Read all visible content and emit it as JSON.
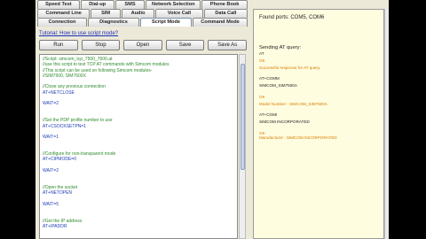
{
  "tabs": {
    "row1": [
      "Speed Test",
      "Dial-up",
      "SMS",
      "Network Selection",
      "Phone Book"
    ],
    "row2": [
      "Command Line",
      "SIM",
      "Audio",
      "Voice Call",
      "Data Call"
    ],
    "row3": [
      "Connection",
      "Diagnostics",
      "Script Mode",
      "Command Mode"
    ],
    "active": "Script Mode"
  },
  "tutorial_link": "Tutorial: How to use script mode?",
  "toolbar": {
    "run": "Run",
    "stop": "Stop",
    "open": "Open",
    "save": "Save",
    "save_as": "Save As"
  },
  "script_lines": [
    {
      "t": "//Script: simcom_tcp_7500_7600.at",
      "c": "c"
    },
    {
      "t": "//use this script to test TCP AT commands with Simcom modules",
      "c": "c"
    },
    {
      "t": "//This script can be used on following Simcom modules-",
      "c": "c"
    },
    {
      "t": "//SIM7500, SIM7600X",
      "c": "c"
    },
    {
      "t": "",
      "c": "k"
    },
    {
      "t": "//Close any previous connection",
      "c": "c"
    },
    {
      "t": "AT+NETCLOSE",
      "c": "k"
    },
    {
      "t": "",
      "c": "k"
    },
    {
      "t": "WAIT=2",
      "c": "k"
    },
    {
      "t": "",
      "c": "k"
    },
    {
      "t": "",
      "c": "k"
    },
    {
      "t": "//Set the PDP profile number to use",
      "c": "c"
    },
    {
      "t": "AT+CSOCKSETPN=1",
      "c": "k"
    },
    {
      "t": "",
      "c": "k"
    },
    {
      "t": "WAIT=1",
      "c": "k"
    },
    {
      "t": "",
      "c": "k"
    },
    {
      "t": "",
      "c": "k"
    },
    {
      "t": "//Configure for non-transparent mode",
      "c": "c"
    },
    {
      "t": "AT+CIPMODE=0",
      "c": "k"
    },
    {
      "t": "",
      "c": "k"
    },
    {
      "t": "WAIT=2",
      "c": "k"
    },
    {
      "t": "",
      "c": "k"
    },
    {
      "t": "",
      "c": "k"
    },
    {
      "t": "//Open the socket",
      "c": "c"
    },
    {
      "t": "AT+NETOPEN",
      "c": "k"
    },
    {
      "t": "",
      "c": "k"
    },
    {
      "t": "WAIT=5",
      "c": "k"
    },
    {
      "t": "",
      "c": "k"
    },
    {
      "t": "",
      "c": "k"
    },
    {
      "t": "//Get the IP address",
      "c": "c"
    },
    {
      "t": "AT+IPADDR",
      "c": "k"
    }
  ],
  "console": {
    "found_ports": "Found ports: COM5, COM6",
    "sending": "Sending AT query:",
    "lines": [
      {
        "t": "AT",
        "c": "blk"
      },
      {
        "t": "OK",
        "c": "org"
      },
      {
        "t": "Successful response for AT query.",
        "c": "org"
      },
      {
        "t": "AT+CGMM",
        "c": "blk"
      },
      {
        "t": "SIMCOM_SIM7500A",
        "c": "blk"
      },
      {
        "t": "OK",
        "c": "org"
      },
      {
        "t": "Model Number : SIMCOM_SIM7500A",
        "c": "org"
      },
      {
        "t": "AT+CGMI",
        "c": "blk"
      },
      {
        "t": "SIMCOM INCORPORATED",
        "c": "blk"
      },
      {
        "t": "OK",
        "c": "org"
      },
      {
        "t": "Manufacturer : SIMCOM INCORPORATED",
        "c": "org"
      }
    ]
  }
}
